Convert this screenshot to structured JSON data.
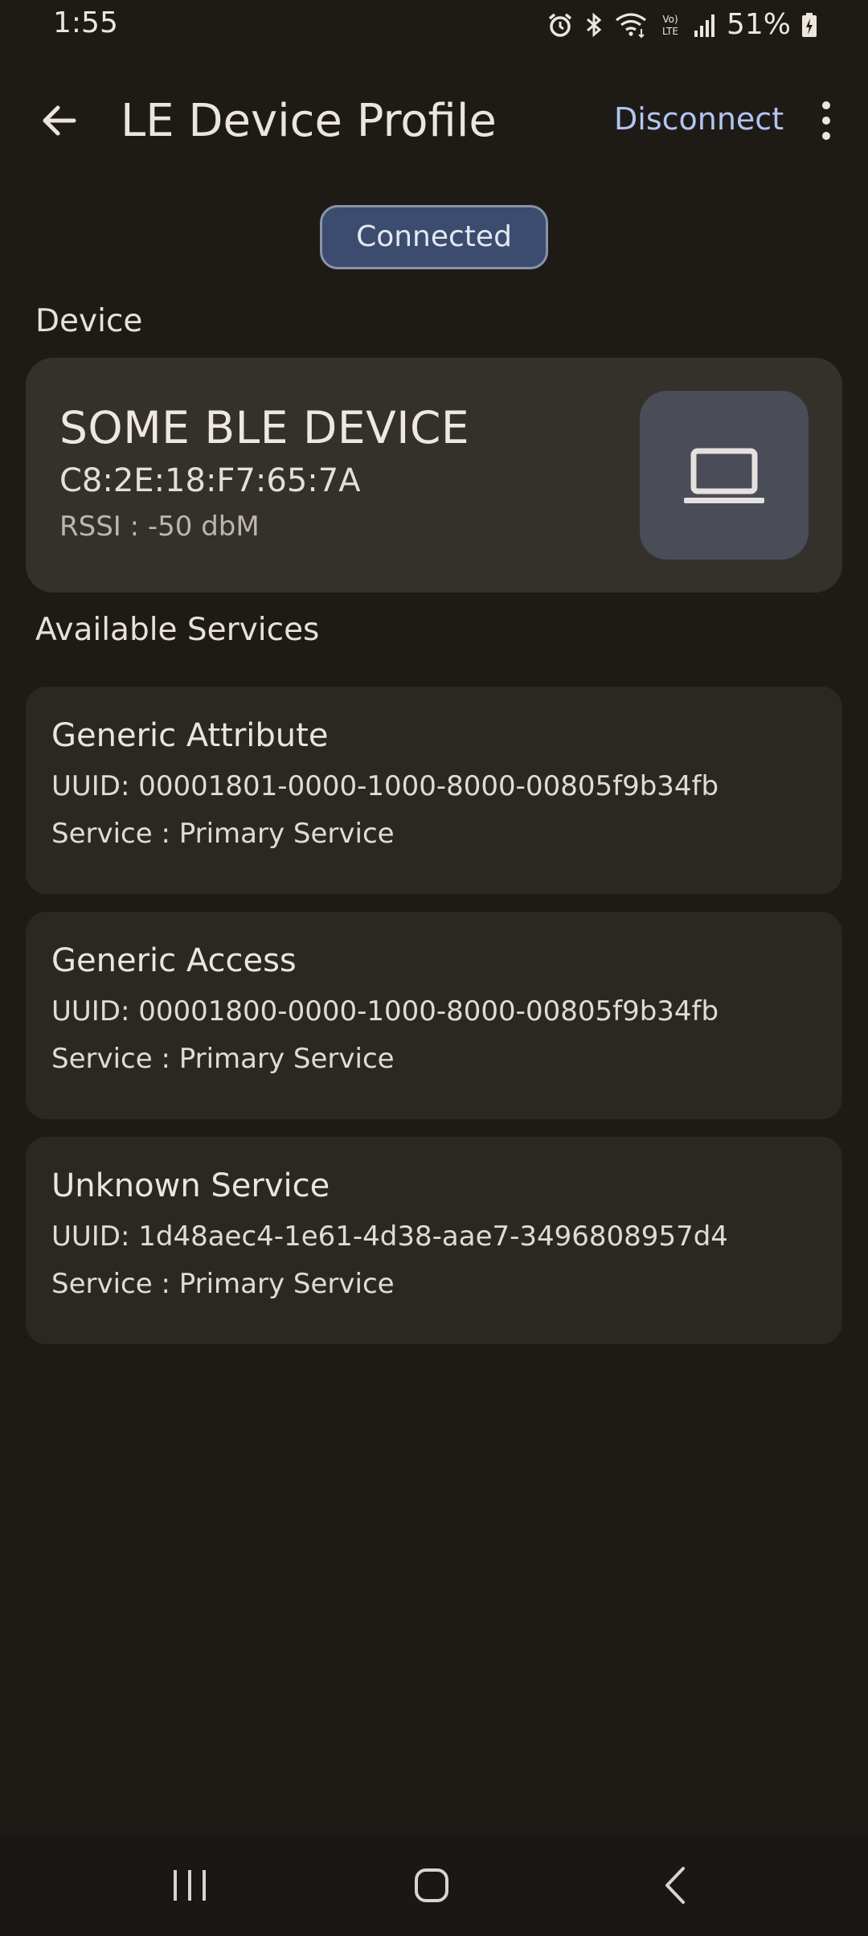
{
  "status_bar": {
    "time": "1:55",
    "battery": "51%",
    "icons": [
      "alarm-icon",
      "bluetooth-icon",
      "wifi-icon",
      "volte-icon",
      "signal-icon",
      "battery-icon"
    ]
  },
  "app_bar": {
    "title": "LE Device Profile",
    "disconnect_label": "Disconnect",
    "back_icon": "arrow-back-icon",
    "menu_icon": "more-vert-icon"
  },
  "connection": {
    "status": "Connected"
  },
  "device_section": {
    "label": "Device",
    "name": "SOME BLE DEVICE",
    "mac": "C8:2E:18:F7:65:7A",
    "rssi": "RSSI : -50 dbM",
    "icon": "laptop-icon"
  },
  "services_section": {
    "label": "Available Services",
    "items": [
      {
        "name": "Generic Attribute",
        "uuid": "UUID: 00001801-0000-1000-8000-00805f9b34fb",
        "type": "Service : Primary Service"
      },
      {
        "name": "Generic Access",
        "uuid": "UUID: 00001800-0000-1000-8000-00805f9b34fb",
        "type": "Service : Primary Service"
      },
      {
        "name": "Unknown Service",
        "uuid": "UUID: 1d48aec4-1e61-4d38-aae7-3496808957d4",
        "type": "Service : Primary Service"
      }
    ]
  },
  "nav_bar": {
    "icons": [
      "recent-apps-icon",
      "home-icon",
      "nav-back-icon"
    ]
  },
  "colors": {
    "background": "#1e1b17",
    "accent": "#b3c4f2",
    "chip": "#3b4c6e",
    "device_card": "#34302b",
    "service_card": "#2b2824"
  }
}
